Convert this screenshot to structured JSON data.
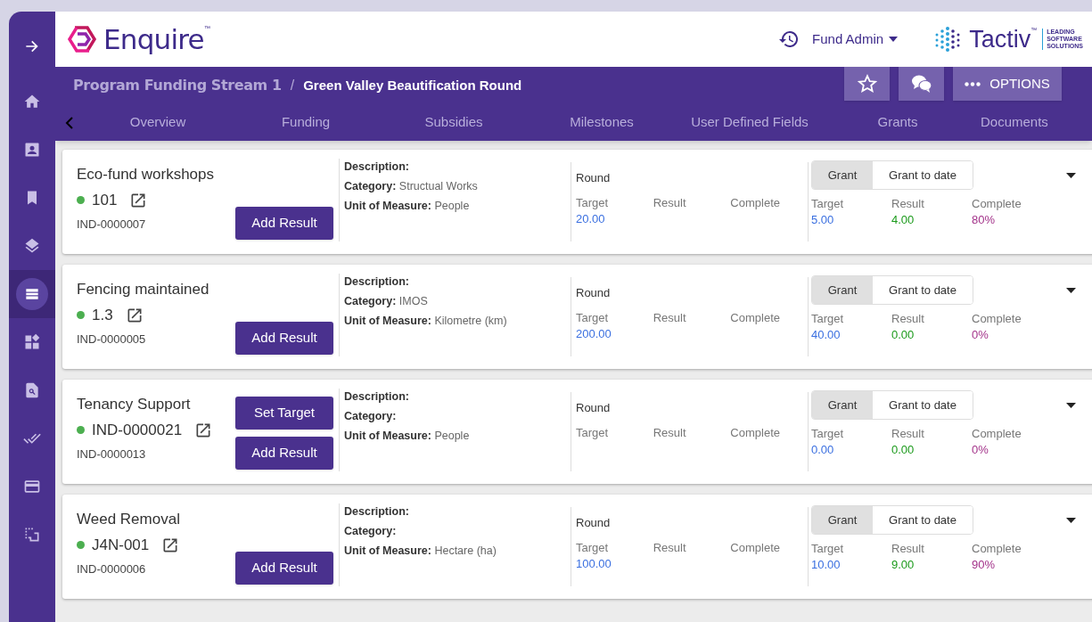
{
  "sidebar": {
    "items": [
      {
        "kind": "expand",
        "selected": false
      },
      {
        "kind": "home",
        "selected": false
      },
      {
        "kind": "contact",
        "selected": false
      },
      {
        "kind": "bookmark",
        "selected": false
      },
      {
        "kind": "layers",
        "selected": false
      },
      {
        "kind": "list",
        "selected": true
      },
      {
        "kind": "widgets",
        "selected": false
      },
      {
        "kind": "search-doc",
        "selected": false
      },
      {
        "kind": "done-all",
        "selected": false
      },
      {
        "kind": "card",
        "selected": false
      },
      {
        "kind": "select",
        "selected": false
      }
    ]
  },
  "header": {
    "logo": {
      "name": "Enquire",
      "mark": "™"
    },
    "user": "Fund Admin",
    "brand": {
      "name": "Tactiv",
      "mark": "™",
      "tagline": [
        "LEADING",
        "SOFTWARE",
        "SOLUTIONS"
      ]
    }
  },
  "breadcrumb": {
    "parent": "Program Funding Stream 1",
    "separator": "/",
    "current": "Green Valley Beautification Round"
  },
  "actions": {
    "options": "OPTIONS"
  },
  "tabs": [
    {
      "label": "Overview",
      "selected": false
    },
    {
      "label": "Funding",
      "selected": false
    },
    {
      "label": "Subsidies",
      "selected": false
    },
    {
      "label": "Milestones",
      "selected": false
    },
    {
      "label": "User Defined Fields",
      "selected": false
    },
    {
      "label": "Grants",
      "selected": false
    },
    {
      "label": "Documents",
      "selected": false
    }
  ],
  "indicators": [
    {
      "name": "Eco-fund workshops",
      "color": "#4caf50",
      "code": "101",
      "id": "IND-0000007",
      "buttons": [
        "Add Result"
      ],
      "fields": [
        {
          "label": "Description:"
        },
        {
          "label": "Category:",
          "value": "Structual Works"
        },
        {
          "label": "Unit of Measure:",
          "value": "People"
        }
      ],
      "round": {
        "title": "Round",
        "metrics": [
          {
            "kind": "target",
            "label": "Target",
            "value": "20.00"
          },
          {
            "label": "Result"
          },
          {
            "label": "Complete"
          }
        ]
      },
      "grant": {
        "toggle": [
          {
            "label": "Grant",
            "selected": true
          },
          {
            "label": "Grant to date",
            "selected": false
          }
        ],
        "metrics": [
          {
            "kind": "target",
            "label": "Target",
            "value": "5.00"
          },
          {
            "kind": "result",
            "label": "Result",
            "value": "4.00"
          },
          {
            "kind": "complete",
            "label": "Complete",
            "value": "80%"
          }
        ]
      }
    },
    {
      "name": "Fencing maintained",
      "color": "#4caf50",
      "code": "1.3",
      "id": "IND-0000005",
      "buttons": [
        "Add Result"
      ],
      "fields": [
        {
          "label": "Description:"
        },
        {
          "label": "Category:",
          "value": "IMOS"
        },
        {
          "label": "Unit of Measure:",
          "value": "Kilometre (km)"
        }
      ],
      "round": {
        "title": "Round",
        "metrics": [
          {
            "kind": "target",
            "label": "Target",
            "value": "200.00"
          },
          {
            "label": "Result"
          },
          {
            "label": "Complete"
          }
        ]
      },
      "grant": {
        "toggle": [
          {
            "label": "Grant",
            "selected": true
          },
          {
            "label": "Grant to date",
            "selected": false
          }
        ],
        "metrics": [
          {
            "kind": "target",
            "label": "Target",
            "value": "40.00"
          },
          {
            "kind": "result",
            "label": "Result",
            "value": "0.00"
          },
          {
            "kind": "complete",
            "label": "Complete",
            "value": "0%"
          }
        ]
      }
    },
    {
      "name": "Tenancy Support",
      "color": "#4caf50",
      "code": "IND-0000021",
      "id": "IND-0000013",
      "buttons": [
        "Set Target",
        "Add Result"
      ],
      "fields": [
        {
          "label": "Description:"
        },
        {
          "label": "Category:"
        },
        {
          "label": "Unit of Measure:",
          "value": "People"
        }
      ],
      "round": {
        "title": "Round",
        "metrics": [
          {
            "label": "Target"
          },
          {
            "label": "Result"
          },
          {
            "label": "Complete"
          }
        ]
      },
      "grant": {
        "toggle": [
          {
            "label": "Grant",
            "selected": true
          },
          {
            "label": "Grant to date",
            "selected": false
          }
        ],
        "metrics": [
          {
            "kind": "target",
            "label": "Target",
            "value": "0.00"
          },
          {
            "kind": "result",
            "label": "Result",
            "value": "0.00"
          },
          {
            "kind": "complete",
            "label": "Complete",
            "value": "0%"
          }
        ]
      }
    },
    {
      "name": "Weed Removal",
      "color": "#4caf50",
      "code": "J4N-001",
      "id": "IND-0000006",
      "buttons": [
        "Add Result"
      ],
      "fields": [
        {
          "label": "Description:"
        },
        {
          "label": "Category:"
        },
        {
          "label": "Unit of Measure:",
          "value": "Hectare (ha)"
        }
      ],
      "round": {
        "title": "Round",
        "metrics": [
          {
            "kind": "target",
            "label": "Target",
            "value": "100.00"
          },
          {
            "label": "Result"
          },
          {
            "label": "Complete"
          }
        ]
      },
      "grant": {
        "toggle": [
          {
            "label": "Grant",
            "selected": true
          },
          {
            "label": "Grant to date",
            "selected": false
          }
        ],
        "metrics": [
          {
            "kind": "target",
            "label": "Target",
            "value": "10.00"
          },
          {
            "kind": "result",
            "label": "Result",
            "value": "9.00"
          },
          {
            "kind": "complete",
            "label": "Complete",
            "value": "90%"
          }
        ]
      }
    }
  ]
}
